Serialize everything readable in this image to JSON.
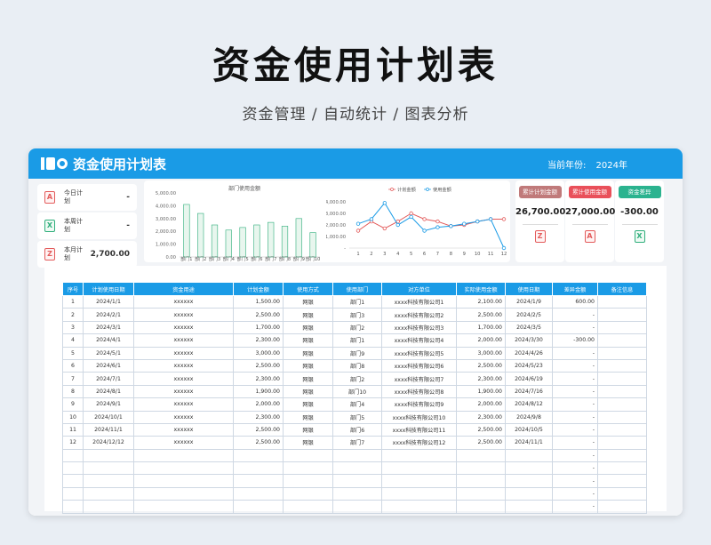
{
  "hero": {
    "title": "资金使用计划表",
    "subtitle": "资金管理 / 自动统计 / 图表分析"
  },
  "header": {
    "title": "资金使用计划表",
    "year_label": "当前年份:",
    "year_value": "2024年"
  },
  "stats": [
    {
      "label": "今日计划",
      "value": "-",
      "icon": "pdf-icon"
    },
    {
      "label": "本周计划",
      "value": "-",
      "icon": "excel-icon"
    },
    {
      "label": "本月计划",
      "value": "2,700.00",
      "icon": "z-icon"
    }
  ],
  "kpis": [
    {
      "tag": "累计计划金额",
      "value": "26,700.00",
      "color": "#c07a7a",
      "icon": "z-icon"
    },
    {
      "tag": "累计使用金额",
      "value": "27,000.00",
      "color": "#e9505a",
      "icon": "pdf-icon"
    },
    {
      "tag": "资金差异",
      "value": "-300.00",
      "color": "#2bb38f",
      "icon": "excel-icon"
    }
  ],
  "icons": {
    "pdf": "A",
    "xls": "X",
    "z": "Z"
  },
  "colors": {
    "accent": "#1a9be6",
    "bar": "#2fae7b",
    "plan_line": "#e35b5b",
    "use_line": "#1a9be6"
  },
  "chart_data": [
    {
      "type": "bar",
      "title": "部门使用金额",
      "categories": [
        "部门1",
        "部门2",
        "部门3",
        "部门4",
        "部门5",
        "部门6",
        "部门7",
        "部门8",
        "部门9",
        "部门10"
      ],
      "values": [
        4100,
        3400,
        2500,
        2100,
        2300,
        2500,
        2700,
        2400,
        3000,
        1900
      ],
      "ylim": [
        0,
        5000
      ],
      "yticks": [
        "0.00",
        "1,000.00",
        "2,000.00",
        "3,000.00",
        "4,000.00",
        "5,000.00"
      ]
    },
    {
      "type": "line",
      "categories": [
        "1",
        "2",
        "3",
        "4",
        "5",
        "6",
        "7",
        "8",
        "9",
        "10",
        "11",
        "12"
      ],
      "series": [
        {
          "name": "计划金额",
          "values": [
            1500,
            2300,
            1700,
            2300,
            3000,
            2500,
            2300,
            1900,
            2000,
            2300,
            2500,
            2500
          ]
        },
        {
          "name": "使用金额",
          "values": [
            2100,
            2500,
            3900,
            2000,
            2700,
            1500,
            1800,
            1900,
            2100,
            2300,
            2500,
            0
          ]
        }
      ],
      "ylim": [
        0,
        4000
      ],
      "yticks": [
        "-",
        "1,000.00",
        "2,000.00",
        "3,000.00",
        "4,000.00"
      ]
    }
  ],
  "table": {
    "headers": [
      "序号",
      "计划使用日期",
      "资金用途",
      "计划金额",
      "使用方式",
      "使用部门",
      "对方单位",
      "实际使用金额",
      "使用日期",
      "差异金额",
      "备注信息"
    ],
    "rows": [
      [
        "1",
        "2024/1/1",
        "xxxxxx",
        "1,500.00",
        "网银",
        "部门1",
        "xxxx科技有限公司1",
        "2,100.00",
        "2024/1/9",
        "600.00",
        ""
      ],
      [
        "2",
        "2024/2/1",
        "xxxxxx",
        "2,500.00",
        "网银",
        "部门3",
        "xxxx科技有限公司2",
        "2,500.00",
        "2024/2/5",
        "-",
        ""
      ],
      [
        "3",
        "2024/3/1",
        "xxxxxx",
        "1,700.00",
        "网银",
        "部门2",
        "xxxx科技有限公司3",
        "1,700.00",
        "2024/3/5",
        "-",
        ""
      ],
      [
        "4",
        "2024/4/1",
        "xxxxxx",
        "2,300.00",
        "网银",
        "部门1",
        "xxxx科技有限公司4",
        "2,000.00",
        "2024/3/30",
        "-300.00",
        ""
      ],
      [
        "5",
        "2024/5/1",
        "xxxxxx",
        "3,000.00",
        "网银",
        "部门9",
        "xxxx科技有限公司5",
        "3,000.00",
        "2024/4/26",
        "-",
        ""
      ],
      [
        "6",
        "2024/6/1",
        "xxxxxx",
        "2,500.00",
        "网银",
        "部门8",
        "xxxx科技有限公司6",
        "2,500.00",
        "2024/5/23",
        "-",
        ""
      ],
      [
        "7",
        "2024/7/1",
        "xxxxxx",
        "2,300.00",
        "网银",
        "部门2",
        "xxxx科技有限公司7",
        "2,300.00",
        "2024/6/19",
        "-",
        ""
      ],
      [
        "8",
        "2024/8/1",
        "xxxxxx",
        "1,900.00",
        "网银",
        "部门10",
        "xxxx科技有限公司8",
        "1,900.00",
        "2024/7/16",
        "-",
        ""
      ],
      [
        "9",
        "2024/9/1",
        "xxxxxx",
        "2,000.00",
        "网银",
        "部门4",
        "xxxx科技有限公司9",
        "2,000.00",
        "2024/8/12",
        "-",
        ""
      ],
      [
        "10",
        "2024/10/1",
        "xxxxxx",
        "2,300.00",
        "网银",
        "部门5",
        "xxxx科技有限公司10",
        "2,300.00",
        "2024/9/8",
        "-",
        ""
      ],
      [
        "11",
        "2024/11/1",
        "xxxxxx",
        "2,500.00",
        "网银",
        "部门6",
        "xxxx科技有限公司11",
        "2,500.00",
        "2024/10/5",
        "-",
        ""
      ],
      [
        "12",
        "2024/12/12",
        "xxxxxx",
        "2,500.00",
        "网银",
        "部门7",
        "xxxx科技有限公司12",
        "2,500.00",
        "2024/11/1",
        "-",
        ""
      ],
      [
        "",
        "",
        "",
        "",
        "",
        "",
        "",
        "",
        "",
        "-",
        ""
      ],
      [
        "",
        "",
        "",
        "",
        "",
        "",
        "",
        "",
        "",
        "-",
        ""
      ],
      [
        "",
        "",
        "",
        "",
        "",
        "",
        "",
        "",
        "",
        "-",
        ""
      ],
      [
        "",
        "",
        "",
        "",
        "",
        "",
        "",
        "",
        "",
        "-",
        ""
      ],
      [
        "",
        "",
        "",
        "",
        "",
        "",
        "",
        "",
        "",
        "-",
        ""
      ]
    ]
  }
}
